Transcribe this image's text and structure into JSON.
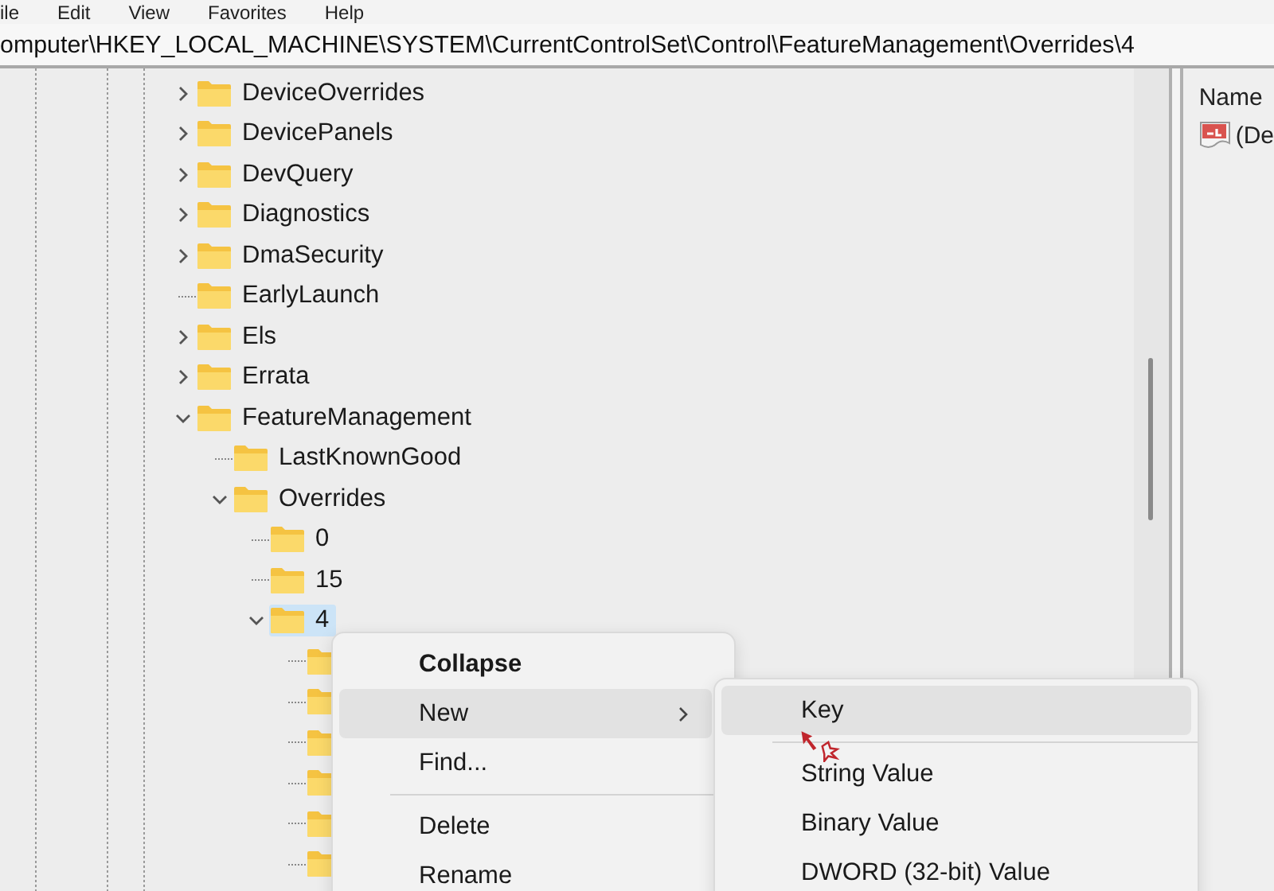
{
  "menu_bar": [
    "ile",
    "Edit",
    "View",
    "Favorites",
    "Help"
  ],
  "address_bar": {
    "value": "omputer\\HKEY_LOCAL_MACHINE\\SYSTEM\\CurrentControlSet\\Control\\FeatureManagement\\Overrides\\4"
  },
  "tree": [
    {
      "label": "DeviceOverrides",
      "kind": "branch",
      "expanded": false,
      "selected": false
    },
    {
      "label": "DevicePanels",
      "kind": "branch",
      "expanded": false,
      "selected": false
    },
    {
      "label": "DevQuery",
      "kind": "branch",
      "expanded": false,
      "selected": false
    },
    {
      "label": "Diagnostics",
      "kind": "branch",
      "expanded": false,
      "selected": false
    },
    {
      "label": "DmaSecurity",
      "kind": "branch",
      "expanded": false,
      "selected": false
    },
    {
      "label": "EarlyLaunch",
      "kind": "leaf",
      "selected": false
    },
    {
      "label": "Els",
      "kind": "branch",
      "expanded": false,
      "selected": false
    },
    {
      "label": "Errata",
      "kind": "branch",
      "expanded": false,
      "selected": false
    },
    {
      "label": "FeatureManagement",
      "kind": "branch",
      "expanded": true,
      "selected": false,
      "children": [
        {
          "label": "LastKnownGood",
          "kind": "leaf",
          "selected": false
        },
        {
          "label": "Overrides",
          "kind": "branch",
          "expanded": true,
          "selected": false,
          "children": [
            {
              "label": "0",
              "kind": "leaf",
              "selected": false
            },
            {
              "label": "15",
              "kind": "leaf",
              "selected": false
            },
            {
              "label": "4",
              "kind": "branch",
              "expanded": true,
              "selected": true,
              "children": [
                {
                  "kind": "leaf",
                  "selected": false
                },
                {
                  "kind": "leaf",
                  "selected": false
                },
                {
                  "kind": "leaf",
                  "selected": false
                },
                {
                  "kind": "leaf",
                  "selected": false
                },
                {
                  "kind": "leaf",
                  "selected": false
                },
                {
                  "kind": "leaf",
                  "selected": false
                }
              ]
            }
          ]
        }
      ]
    }
  ],
  "values_pane": {
    "columns": [
      "Name"
    ],
    "rows": [
      {
        "name": "(De"
      }
    ]
  },
  "context_menu": {
    "items": [
      {
        "kind": "item",
        "label": "Collapse",
        "bold": true,
        "submenu": false,
        "selected": false
      },
      {
        "kind": "item",
        "label": "New",
        "bold": false,
        "submenu": true,
        "selected": true
      },
      {
        "kind": "item",
        "label": "Find...",
        "bold": false,
        "submenu": false,
        "selected": false
      },
      {
        "kind": "separator"
      },
      {
        "kind": "item",
        "label": "Delete",
        "bold": false,
        "submenu": false,
        "selected": false
      },
      {
        "kind": "item",
        "label": "Rename",
        "bold": false,
        "submenu": false,
        "selected": false
      }
    ]
  },
  "submenu": {
    "items": [
      {
        "kind": "item",
        "label": "Key",
        "selected": true
      },
      {
        "kind": "separator"
      },
      {
        "kind": "item",
        "label": "String Value",
        "selected": false
      },
      {
        "kind": "item",
        "label": "Binary Value",
        "selected": false
      },
      {
        "kind": "item",
        "label": "DWORD (32-bit) Value",
        "selected": false
      }
    ]
  }
}
